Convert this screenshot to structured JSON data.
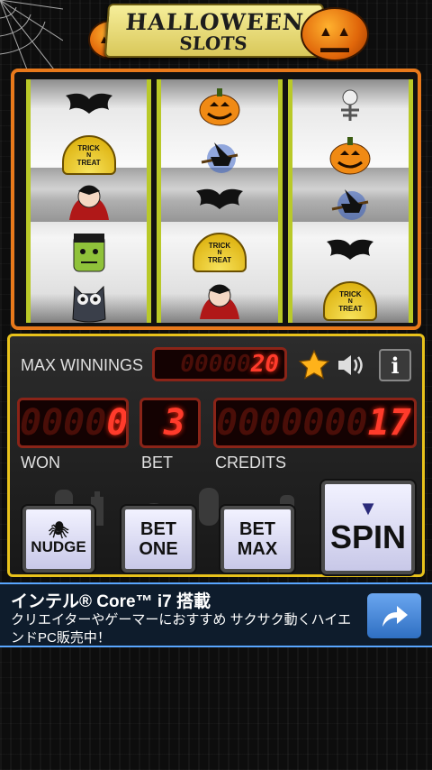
{
  "header": {
    "title": "HALLOWEEN",
    "subtitle": "SLOTS"
  },
  "reels": [
    [
      "bat",
      "trick-n-treat",
      "vampire",
      "frankenstein",
      "owl"
    ],
    [
      "pumpkin",
      "witch",
      "bat",
      "trick-n-treat",
      "vampire"
    ],
    [
      "skeleton",
      "pumpkin",
      "witch",
      "bat",
      "trick-n-treat"
    ]
  ],
  "symbol_text": {
    "trick": "TRICK",
    "n": "N",
    "treat": "TREAT"
  },
  "panel": {
    "max_winnings_label": "MAX WINNINGS",
    "max_winnings_value": "20",
    "max_winnings_ghost": "00000",
    "won_label": "WON",
    "won_value": "0",
    "won_ghost": "0000",
    "bet_label": "BET",
    "bet_value": "3",
    "credits_label": "CREDITS",
    "credits_value": "17",
    "credits_ghost": "0000000"
  },
  "buttons": {
    "nudge": "NUDGE",
    "bet_one_line1": "BET",
    "bet_one_line2": "ONE",
    "bet_max_line1": "BET",
    "bet_max_line2": "MAX",
    "spin": "SPIN"
  },
  "ad": {
    "title": "インテル® Core™ i7 搭載",
    "text": "クリエイターやゲーマーにおすすめ サクサク動くハイエンドPC販売中！"
  },
  "colors": {
    "frame": "#e8791b",
    "panel_border": "#e8c21b",
    "led": "#ff3b2b",
    "ad_border": "#59a6ff"
  }
}
